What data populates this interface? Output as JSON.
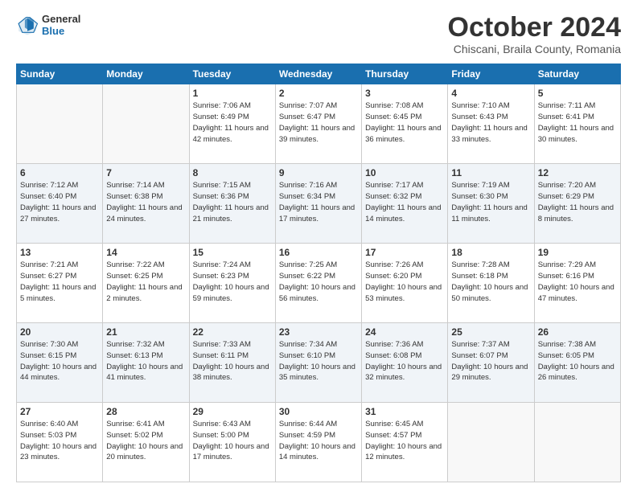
{
  "logo": {
    "general": "General",
    "blue": "Blue"
  },
  "header": {
    "month": "October 2024",
    "location": "Chiscani, Braila County, Romania"
  },
  "weekdays": [
    "Sunday",
    "Monday",
    "Tuesday",
    "Wednesday",
    "Thursday",
    "Friday",
    "Saturday"
  ],
  "weeks": [
    [
      {
        "day": "",
        "info": ""
      },
      {
        "day": "",
        "info": ""
      },
      {
        "day": "1",
        "info": "Sunrise: 7:06 AM\nSunset: 6:49 PM\nDaylight: 11 hours and 42 minutes."
      },
      {
        "day": "2",
        "info": "Sunrise: 7:07 AM\nSunset: 6:47 PM\nDaylight: 11 hours and 39 minutes."
      },
      {
        "day": "3",
        "info": "Sunrise: 7:08 AM\nSunset: 6:45 PM\nDaylight: 11 hours and 36 minutes."
      },
      {
        "day": "4",
        "info": "Sunrise: 7:10 AM\nSunset: 6:43 PM\nDaylight: 11 hours and 33 minutes."
      },
      {
        "day": "5",
        "info": "Sunrise: 7:11 AM\nSunset: 6:41 PM\nDaylight: 11 hours and 30 minutes."
      }
    ],
    [
      {
        "day": "6",
        "info": "Sunrise: 7:12 AM\nSunset: 6:40 PM\nDaylight: 11 hours and 27 minutes."
      },
      {
        "day": "7",
        "info": "Sunrise: 7:14 AM\nSunset: 6:38 PM\nDaylight: 11 hours and 24 minutes."
      },
      {
        "day": "8",
        "info": "Sunrise: 7:15 AM\nSunset: 6:36 PM\nDaylight: 11 hours and 21 minutes."
      },
      {
        "day": "9",
        "info": "Sunrise: 7:16 AM\nSunset: 6:34 PM\nDaylight: 11 hours and 17 minutes."
      },
      {
        "day": "10",
        "info": "Sunrise: 7:17 AM\nSunset: 6:32 PM\nDaylight: 11 hours and 14 minutes."
      },
      {
        "day": "11",
        "info": "Sunrise: 7:19 AM\nSunset: 6:30 PM\nDaylight: 11 hours and 11 minutes."
      },
      {
        "day": "12",
        "info": "Sunrise: 7:20 AM\nSunset: 6:29 PM\nDaylight: 11 hours and 8 minutes."
      }
    ],
    [
      {
        "day": "13",
        "info": "Sunrise: 7:21 AM\nSunset: 6:27 PM\nDaylight: 11 hours and 5 minutes."
      },
      {
        "day": "14",
        "info": "Sunrise: 7:22 AM\nSunset: 6:25 PM\nDaylight: 11 hours and 2 minutes."
      },
      {
        "day": "15",
        "info": "Sunrise: 7:24 AM\nSunset: 6:23 PM\nDaylight: 10 hours and 59 minutes."
      },
      {
        "day": "16",
        "info": "Sunrise: 7:25 AM\nSunset: 6:22 PM\nDaylight: 10 hours and 56 minutes."
      },
      {
        "day": "17",
        "info": "Sunrise: 7:26 AM\nSunset: 6:20 PM\nDaylight: 10 hours and 53 minutes."
      },
      {
        "day": "18",
        "info": "Sunrise: 7:28 AM\nSunset: 6:18 PM\nDaylight: 10 hours and 50 minutes."
      },
      {
        "day": "19",
        "info": "Sunrise: 7:29 AM\nSunset: 6:16 PM\nDaylight: 10 hours and 47 minutes."
      }
    ],
    [
      {
        "day": "20",
        "info": "Sunrise: 7:30 AM\nSunset: 6:15 PM\nDaylight: 10 hours and 44 minutes."
      },
      {
        "day": "21",
        "info": "Sunrise: 7:32 AM\nSunset: 6:13 PM\nDaylight: 10 hours and 41 minutes."
      },
      {
        "day": "22",
        "info": "Sunrise: 7:33 AM\nSunset: 6:11 PM\nDaylight: 10 hours and 38 minutes."
      },
      {
        "day": "23",
        "info": "Sunrise: 7:34 AM\nSunset: 6:10 PM\nDaylight: 10 hours and 35 minutes."
      },
      {
        "day": "24",
        "info": "Sunrise: 7:36 AM\nSunset: 6:08 PM\nDaylight: 10 hours and 32 minutes."
      },
      {
        "day": "25",
        "info": "Sunrise: 7:37 AM\nSunset: 6:07 PM\nDaylight: 10 hours and 29 minutes."
      },
      {
        "day": "26",
        "info": "Sunrise: 7:38 AM\nSunset: 6:05 PM\nDaylight: 10 hours and 26 minutes."
      }
    ],
    [
      {
        "day": "27",
        "info": "Sunrise: 6:40 AM\nSunset: 5:03 PM\nDaylight: 10 hours and 23 minutes."
      },
      {
        "day": "28",
        "info": "Sunrise: 6:41 AM\nSunset: 5:02 PM\nDaylight: 10 hours and 20 minutes."
      },
      {
        "day": "29",
        "info": "Sunrise: 6:43 AM\nSunset: 5:00 PM\nDaylight: 10 hours and 17 minutes."
      },
      {
        "day": "30",
        "info": "Sunrise: 6:44 AM\nSunset: 4:59 PM\nDaylight: 10 hours and 14 minutes."
      },
      {
        "day": "31",
        "info": "Sunrise: 6:45 AM\nSunset: 4:57 PM\nDaylight: 10 hours and 12 minutes."
      },
      {
        "day": "",
        "info": ""
      },
      {
        "day": "",
        "info": ""
      }
    ]
  ]
}
